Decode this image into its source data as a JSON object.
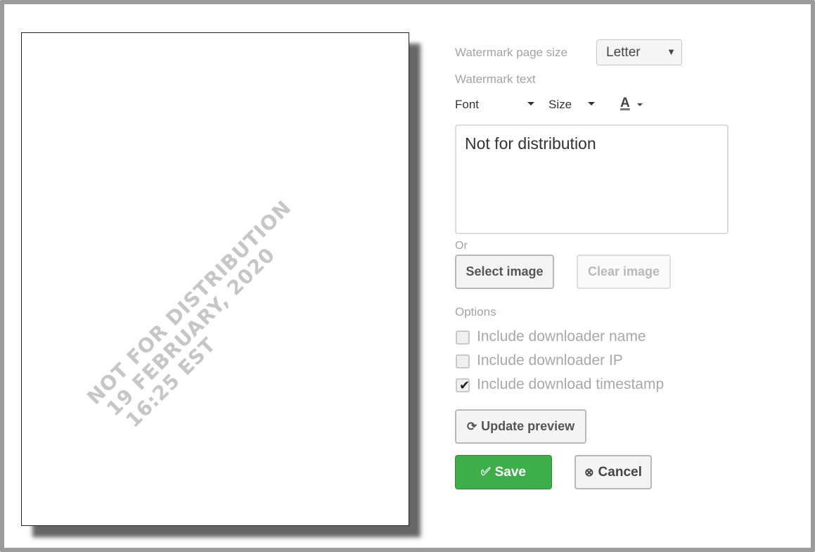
{
  "preview": {
    "watermark_lines": [
      "NOT FOR DISTRIBUTION",
      "19 FEBRUARY, 2020",
      "16:25 EST"
    ]
  },
  "settings": {
    "page_size_label": "Watermark page size",
    "page_size_value": "Letter",
    "watermark_text_label": "Watermark text",
    "font_label": "Font",
    "size_label": "Size",
    "text_color_icon": "A",
    "watermark_text_value": "Not for distribution",
    "or_label": "Or",
    "select_image_label": "Select image",
    "clear_image_label": "Clear image",
    "options_label": "Options",
    "options": [
      {
        "label": "Include downloader name",
        "checked": false
      },
      {
        "label": "Include downloader IP",
        "checked": false
      },
      {
        "label": "Include download timestamp",
        "checked": true
      }
    ]
  },
  "actions": {
    "update_preview_label": "Update preview",
    "save_label": "Save",
    "cancel_label": "Cancel"
  },
  "icons": {
    "refresh": "refresh-icon",
    "check_circle": "check-circle-icon",
    "cancel_circle": "cancel-circle-icon"
  },
  "colors": {
    "save_bg": "#3eae4a",
    "watermark": "#c6c6c6"
  }
}
